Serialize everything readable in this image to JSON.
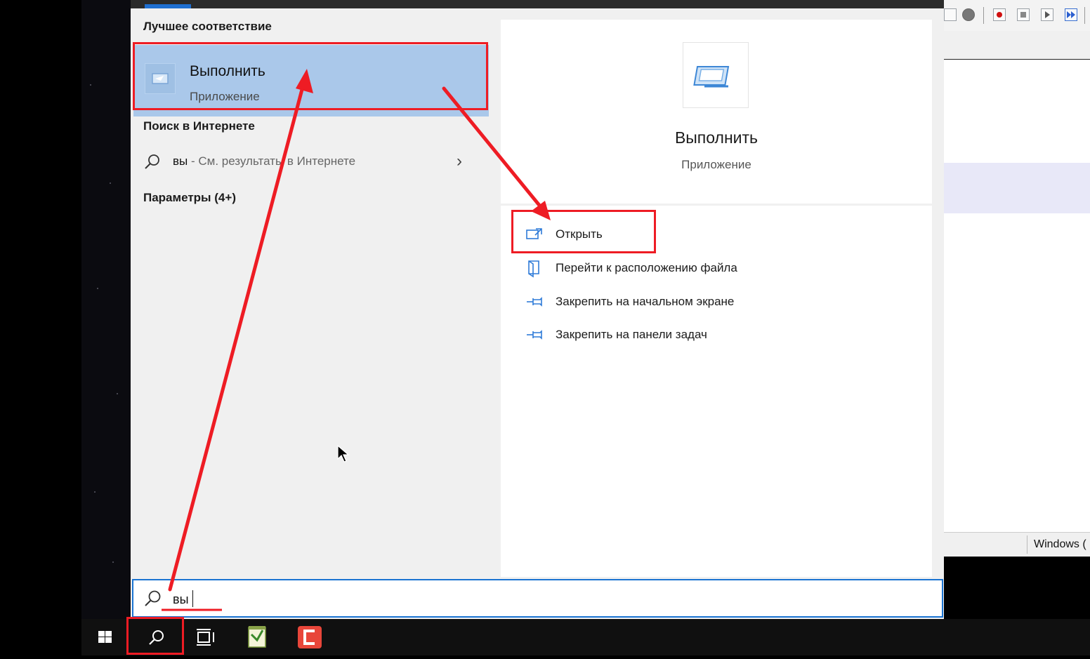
{
  "theme": {
    "accent": "#1f6fd0",
    "selection": "#aac8ea",
    "annotation": "#ee1c24"
  },
  "start_menu": {
    "best_match_title": "Лучшее соответствие",
    "best_match": {
      "name": "Выполнить",
      "type": "Приложение",
      "icon": "run-app-icon"
    },
    "web_section_title": "Поиск в Интернете",
    "web_result": {
      "query": "вы",
      "hint": " - См. результаты в Интернете"
    },
    "settings_section_title": "Параметры (4+)",
    "details": {
      "name": "Выполнить",
      "type": "Приложение",
      "actions": [
        {
          "label": "Открыть",
          "icon": "open-icon"
        },
        {
          "label": "Перейти к расположению файла",
          "icon": "file-location-icon"
        },
        {
          "label": "Закрепить на начальном экране",
          "icon": "pin-start-icon"
        },
        {
          "label": "Закрепить на панели задач",
          "icon": "pin-taskbar-icon"
        }
      ]
    }
  },
  "search": {
    "value": "вы"
  },
  "taskbar": {
    "buttons": [
      "windows-start-icon",
      "search-icon",
      "task-view-icon",
      "notepad-app-icon",
      "red-app-icon"
    ]
  },
  "background_window": {
    "status_text": "Windows ("
  }
}
